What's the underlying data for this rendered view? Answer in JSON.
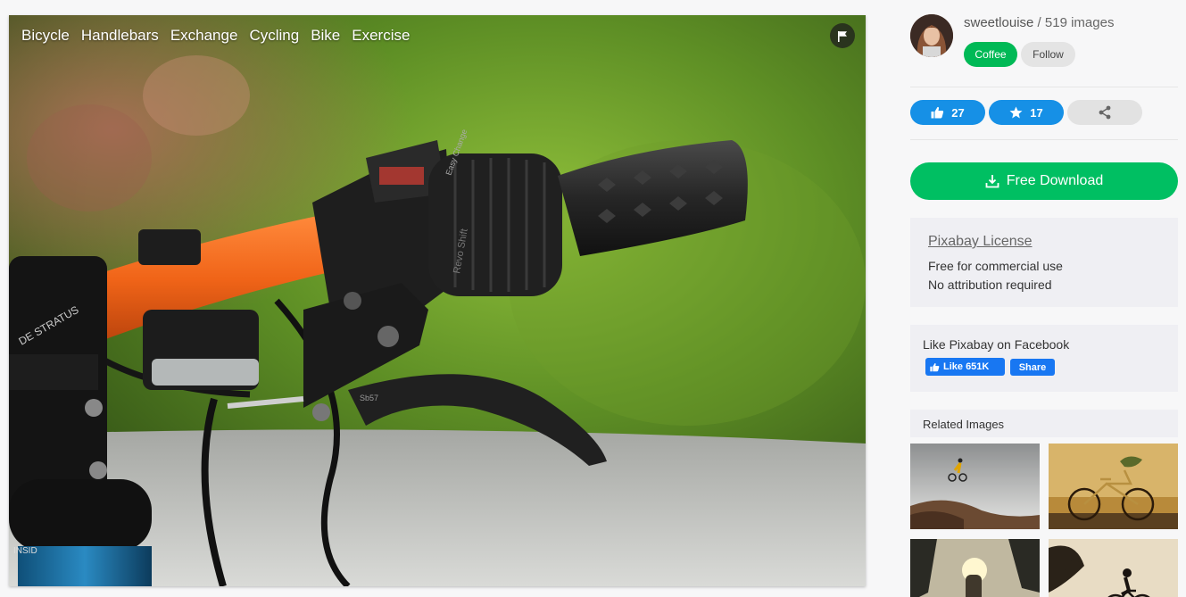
{
  "photo": {
    "tags": [
      "Bicycle",
      "Handlebars",
      "Exchange",
      "Cycling",
      "Bike",
      "Exercise"
    ],
    "grip_text": "Revo Shift",
    "shifter_text": "Easy Change",
    "lever_text": "Sb57",
    "frame_text": "INSID",
    "stem_text": "DE STRATUS"
  },
  "author": {
    "username": "sweetlouise",
    "separator": " / ",
    "images_count": "519 images",
    "coffee_label": "Coffee",
    "follow_label": "Follow"
  },
  "stats": {
    "likes": "27",
    "favorites": "17"
  },
  "download": {
    "label": "Free Download"
  },
  "license": {
    "link": "Pixabay License",
    "line1": "Free for commercial use",
    "line2": "No attribution required"
  },
  "facebook": {
    "title": "Like Pixabay on Facebook",
    "like_label": "Like 651K",
    "share_label": "Share"
  },
  "related": {
    "heading": "Related Images"
  },
  "colors": {
    "green": "#00bf62",
    "blue": "#1690e6",
    "facebook": "#1877f2"
  }
}
